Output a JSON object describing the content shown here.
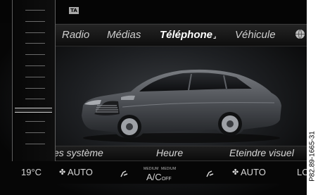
{
  "status": {
    "ta_badge": "TA"
  },
  "menu": {
    "items": [
      {
        "label": "Radio"
      },
      {
        "label": "Médias"
      },
      {
        "label": "Téléphone"
      },
      {
        "label": "Véhicule"
      }
    ],
    "active_index": 2,
    "active_marker": "⌟",
    "globe_icon": "globe-icon"
  },
  "functions": {
    "items": [
      {
        "label": "es système"
      },
      {
        "label": "Heure"
      },
      {
        "label": "Eteindre visuel"
      }
    ]
  },
  "climate": {
    "temperature_left": "19°C",
    "fan_left": "AUTO",
    "fan_right": "AUTO",
    "medium_left": "MEDIUM",
    "medium_right": "MEDIUM",
    "ac_label": "A/C",
    "ac_state": "OFF",
    "right_edge": "LO"
  },
  "temperature_slider": {
    "tick_count": 13,
    "selected_tick": 9
  },
  "reference_code": "P82.89-1665-31",
  "colors": {
    "screen_background": "#000000",
    "menu_text": "#cfcfcf",
    "active_text": "#ffffff",
    "accent": "#cfcfcf"
  }
}
